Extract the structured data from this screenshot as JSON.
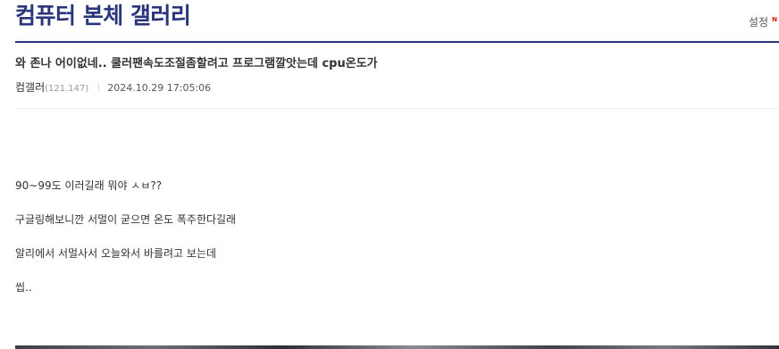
{
  "gallery": {
    "title": "컴퓨터 본체 갤러리",
    "settings_label": "설정",
    "new_badge": "N"
  },
  "post": {
    "title": "와 존나 어이없네.. 쿨러팬속도조절좀할려고 프로그램깔앗는데 cpu온도가",
    "author": "컴갤러",
    "author_ip": "(121.147)",
    "date": "2024.10.29 17:05:06",
    "body_lines": [
      "90~99도 이러길래 뭐야 ㅅㅂ??",
      "구글링해보니깐 서멀이 굳으면 온도 폭주한다길래",
      "알리에서 서멀사서 오늘와서 바를려고 보는데",
      "씹.."
    ]
  },
  "colors": {
    "brand": "#29367c",
    "badge": "#d31900",
    "text": "#333333",
    "muted": "#999999"
  }
}
